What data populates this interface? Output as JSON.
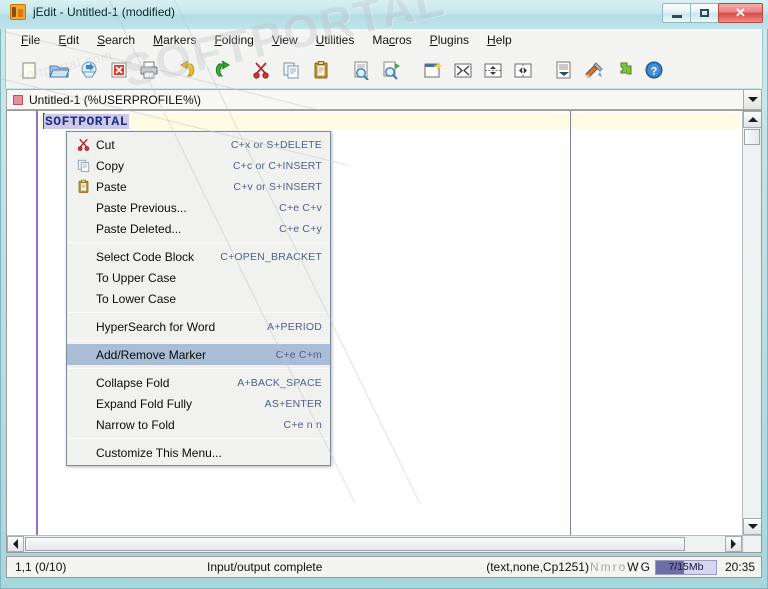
{
  "window": {
    "title": "jEdit - Untitled-1 (modified)",
    "logo_icon": "jedit-logo-icon",
    "minimize_label": "—",
    "maximize_label": "□",
    "close_label": "✕"
  },
  "menubar": {
    "items": [
      {
        "label": "File",
        "mnemonic": "F",
        "rest": "ile"
      },
      {
        "label": "Edit",
        "mnemonic": "E",
        "rest": "dit"
      },
      {
        "label": "Search",
        "mnemonic": "S",
        "rest": "earch"
      },
      {
        "label": "Markers",
        "mnemonic": "M",
        "rest": "arkers"
      },
      {
        "label": "Folding",
        "mnemonic": "F",
        "rest": "olding"
      },
      {
        "label": "View",
        "mnemonic": "V",
        "rest": "iew"
      },
      {
        "label": "Utilities",
        "mnemonic": "U",
        "rest": "tilities"
      },
      {
        "label": "Macros",
        "mnemonic": "M",
        "rest": "acros",
        "pre": "Ma",
        "mn2": "c",
        "post": "ros"
      },
      {
        "label": "Plugins",
        "mnemonic": "P",
        "rest": "lugins"
      },
      {
        "label": "Help",
        "mnemonic": "H",
        "rest": "elp"
      }
    ]
  },
  "toolbar": {
    "buttons": [
      {
        "name": "new-file-icon",
        "tooltip": "New File"
      },
      {
        "name": "open-file-icon",
        "tooltip": "Open File"
      },
      {
        "name": "save-file-icon",
        "tooltip": "Save"
      },
      {
        "name": "close-file-icon",
        "tooltip": "Close File"
      },
      {
        "name": "print-icon",
        "tooltip": "Print"
      },
      {
        "name": "undo-icon",
        "tooltip": "Undo"
      },
      {
        "name": "redo-icon",
        "tooltip": "Redo"
      },
      {
        "name": "cut-icon",
        "tooltip": "Cut"
      },
      {
        "name": "copy-icon",
        "tooltip": "Copy"
      },
      {
        "name": "paste-icon",
        "tooltip": "Paste"
      },
      {
        "name": "find-icon",
        "tooltip": "Find"
      },
      {
        "name": "find-next-icon",
        "tooltip": "Find Next"
      },
      {
        "name": "new-view-icon",
        "tooltip": "New View"
      },
      {
        "name": "unsplit-icon",
        "tooltip": "Unsplit"
      },
      {
        "name": "split-horizontal-icon",
        "tooltip": "Split Horizontally"
      },
      {
        "name": "split-vertical-icon",
        "tooltip": "Split Vertically"
      },
      {
        "name": "word-wrap-icon",
        "tooltip": "Toggle Word Wrap"
      },
      {
        "name": "global-options-icon",
        "tooltip": "Global Options"
      },
      {
        "name": "plugin-manager-icon",
        "tooltip": "Plugin Manager"
      },
      {
        "name": "help-icon",
        "tooltip": "Help"
      }
    ]
  },
  "buffer_switcher": {
    "icon": "modified-buffer-icon",
    "label": "Untitled-1 (%USERPROFILE%\\)",
    "dropdown_icon": "chevron-down-icon"
  },
  "editor": {
    "line_text": "SOFTPORTAL",
    "wrap_guide": true,
    "gutter_color": "#9a6fbf",
    "current_line_color": "#fdfce2",
    "selection_color": "#cdc9ea",
    "text_color": "#1d2f7a"
  },
  "context_menu": {
    "sections": [
      {
        "items": [
          {
            "icon": "cut-icon",
            "label": "Cut",
            "accel": "C+x or S+DELETE",
            "selected": false
          },
          {
            "icon": "copy-icon",
            "label": "Copy",
            "accel": "C+c or C+INSERT",
            "selected": false
          },
          {
            "icon": "paste-icon",
            "label": "Paste",
            "accel": "C+v or S+INSERT",
            "selected": false
          },
          {
            "icon": "",
            "label": "Paste Previous...",
            "accel": "C+e C+v",
            "selected": false
          },
          {
            "icon": "",
            "label": "Paste Deleted...",
            "accel": "C+e C+y",
            "selected": false
          }
        ]
      },
      {
        "items": [
          {
            "icon": "",
            "label": "Select Code Block",
            "accel": "C+OPEN_BRACKET",
            "selected": false
          },
          {
            "icon": "",
            "label": "To Upper Case",
            "accel": "",
            "selected": false
          },
          {
            "icon": "",
            "label": "To Lower Case",
            "accel": "",
            "selected": false
          }
        ]
      },
      {
        "items": [
          {
            "icon": "",
            "label": "HyperSearch for Word",
            "accel": "A+PERIOD",
            "selected": false
          }
        ]
      },
      {
        "items": [
          {
            "icon": "",
            "label": "Add/Remove Marker",
            "accel": "C+e C+m",
            "selected": true
          }
        ]
      },
      {
        "items": [
          {
            "icon": "",
            "label": "Collapse Fold",
            "accel": "A+BACK_SPACE",
            "selected": false
          },
          {
            "icon": "",
            "label": "Expand Fold Fully",
            "accel": "AS+ENTER",
            "selected": false
          },
          {
            "icon": "",
            "label": "Narrow to Fold",
            "accel": "C+e n n",
            "selected": false
          }
        ]
      },
      {
        "items": [
          {
            "icon": "",
            "label": "Customize This Menu...",
            "accel": "",
            "selected": false
          }
        ]
      }
    ],
    "highlight_color": "#a9bdd6"
  },
  "statusbar": {
    "caret": "1,1 (0/10)",
    "message": "Input/output complete",
    "encoding": "(text,none,Cp1251)",
    "toggles": [
      {
        "label": "N",
        "on": false
      },
      {
        "label": "m",
        "on": false
      },
      {
        "label": "r",
        "on": false
      },
      {
        "label": " ",
        "on": false
      },
      {
        "label": "o",
        "on": false
      },
      {
        "label": "W",
        "on": true
      },
      {
        "label": "G",
        "on": true
      }
    ],
    "memory": "7/15Mb",
    "memory_percent": 47,
    "clock": "20:35"
  },
  "watermark": {
    "text": "SOFTPORTAL",
    "subtext": "softportal.com"
  }
}
